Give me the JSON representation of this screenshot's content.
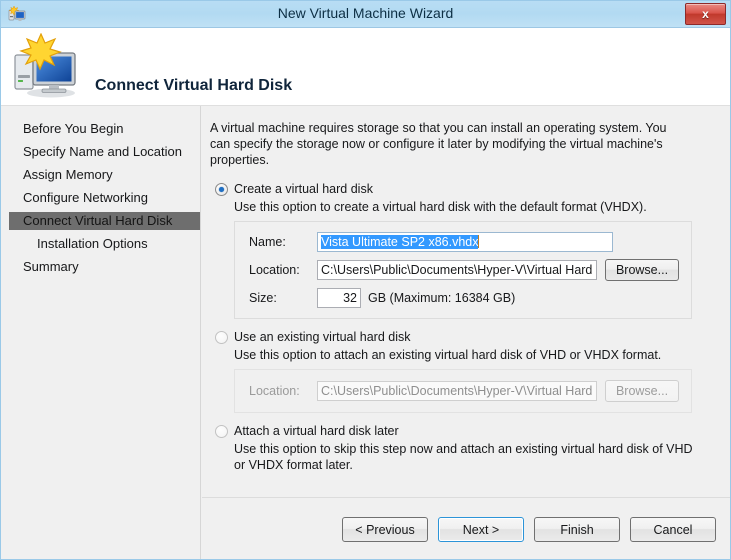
{
  "window": {
    "title": "New Virtual Machine Wizard",
    "icon": "vm-wizard-icon",
    "close_label": "x"
  },
  "header": {
    "title": "Connect Virtual Hard Disk",
    "icon": "new-computer-icon"
  },
  "sidebar": {
    "items": [
      {
        "label": "Before You Begin",
        "active": false,
        "indent": false
      },
      {
        "label": "Specify Name and Location",
        "active": false,
        "indent": false
      },
      {
        "label": "Assign Memory",
        "active": false,
        "indent": false
      },
      {
        "label": "Configure Networking",
        "active": false,
        "indent": false
      },
      {
        "label": "Connect Virtual Hard Disk",
        "active": true,
        "indent": false
      },
      {
        "label": "Installation Options",
        "active": false,
        "indent": true
      },
      {
        "label": "Summary",
        "active": false,
        "indent": false
      }
    ]
  },
  "main": {
    "intro": "A virtual machine requires storage so that you can install an operating system. You can specify the storage now or configure it later by modifying the virtual machine's properties.",
    "option_create": {
      "label": "Create a virtual hard disk",
      "description": "Use this option to create a virtual hard disk with the default format (VHDX).",
      "selected": true,
      "name_label": "Name:",
      "name_value": "Vista Ultimate SP2 x86.vhdx",
      "location_label": "Location:",
      "location_value": "C:\\Users\\Public\\Documents\\Hyper-V\\Virtual Hard Disks\\",
      "browse_label": "Browse...",
      "size_label": "Size:",
      "size_value": "32",
      "size_suffix": "GB (Maximum: 16384 GB)"
    },
    "option_existing": {
      "label": "Use an existing virtual hard disk",
      "description": "Use this option to attach an existing virtual hard disk of VHD or VHDX format.",
      "selected": false,
      "location_label": "Location:",
      "location_value": "C:\\Users\\Public\\Documents\\Hyper-V\\Virtual Hard Disks\\",
      "browse_label": "Browse..."
    },
    "option_later": {
      "label": "Attach a virtual hard disk later",
      "description": "Use this option to skip this step now and attach an existing virtual hard disk of VHD or VHDX format later.",
      "selected": false
    }
  },
  "footer": {
    "previous_label": "< Previous",
    "next_label": "Next >",
    "finish_label": "Finish",
    "cancel_label": "Cancel"
  },
  "colors": {
    "titlebar": "#b5dcf3",
    "accent_blue": "#3399ff",
    "close_red": "#c0392c",
    "nav_active": "#6e6e6e",
    "focus_blue": "#2c94d8"
  }
}
